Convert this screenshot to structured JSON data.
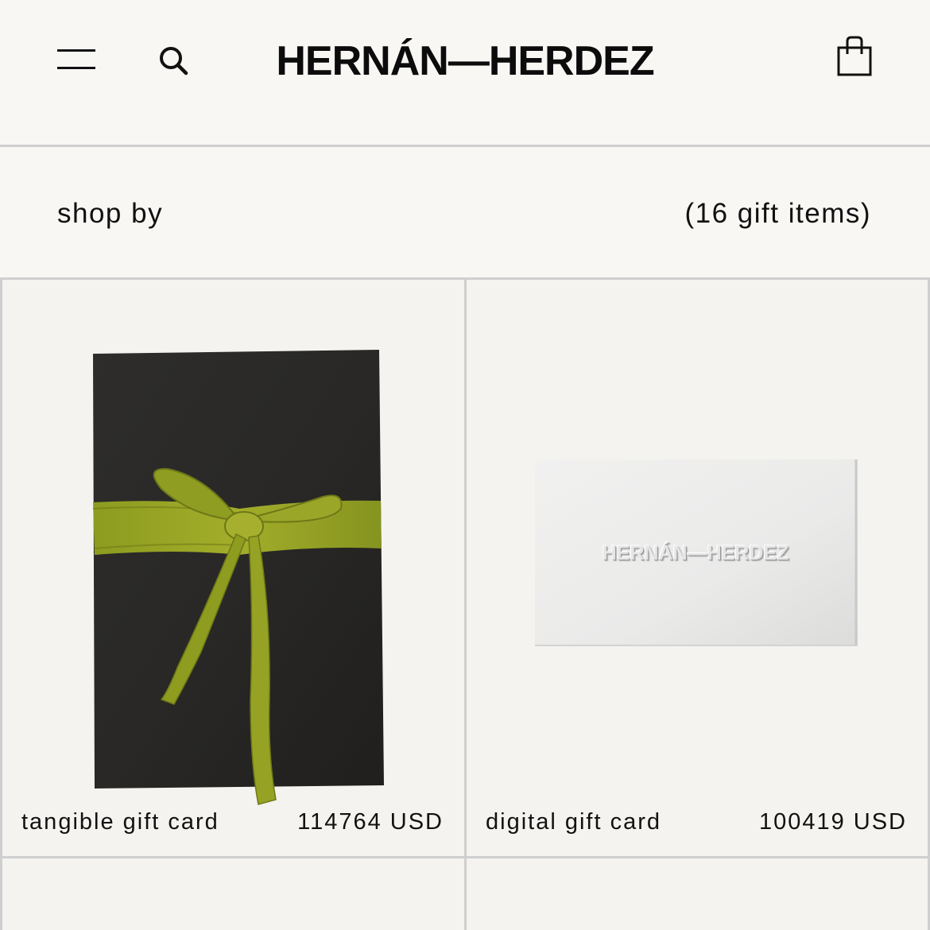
{
  "header": {
    "brand": "HERNÁN—HERDEZ",
    "icons": {
      "menu": "hamburger-menu-icon",
      "search": "search-icon",
      "bag": "shopping-bag-icon"
    }
  },
  "filter_bar": {
    "shop_by_label": "shop by",
    "item_count": "(16 gift items)"
  },
  "products": [
    {
      "name": "tangible gift card",
      "price": "114764 USD",
      "image": "black envelope tied with olive-green ribbon"
    },
    {
      "name": "digital gift card",
      "price": "100419 USD",
      "image": "white embossed card",
      "card_text": "HERNÁN—HERDEZ"
    }
  ],
  "colors": {
    "background": "#f8f7f4",
    "divider": "#cfcfcf",
    "text": "#111111",
    "ribbon": "#8a9a1e",
    "envelope": "#2a2927"
  }
}
